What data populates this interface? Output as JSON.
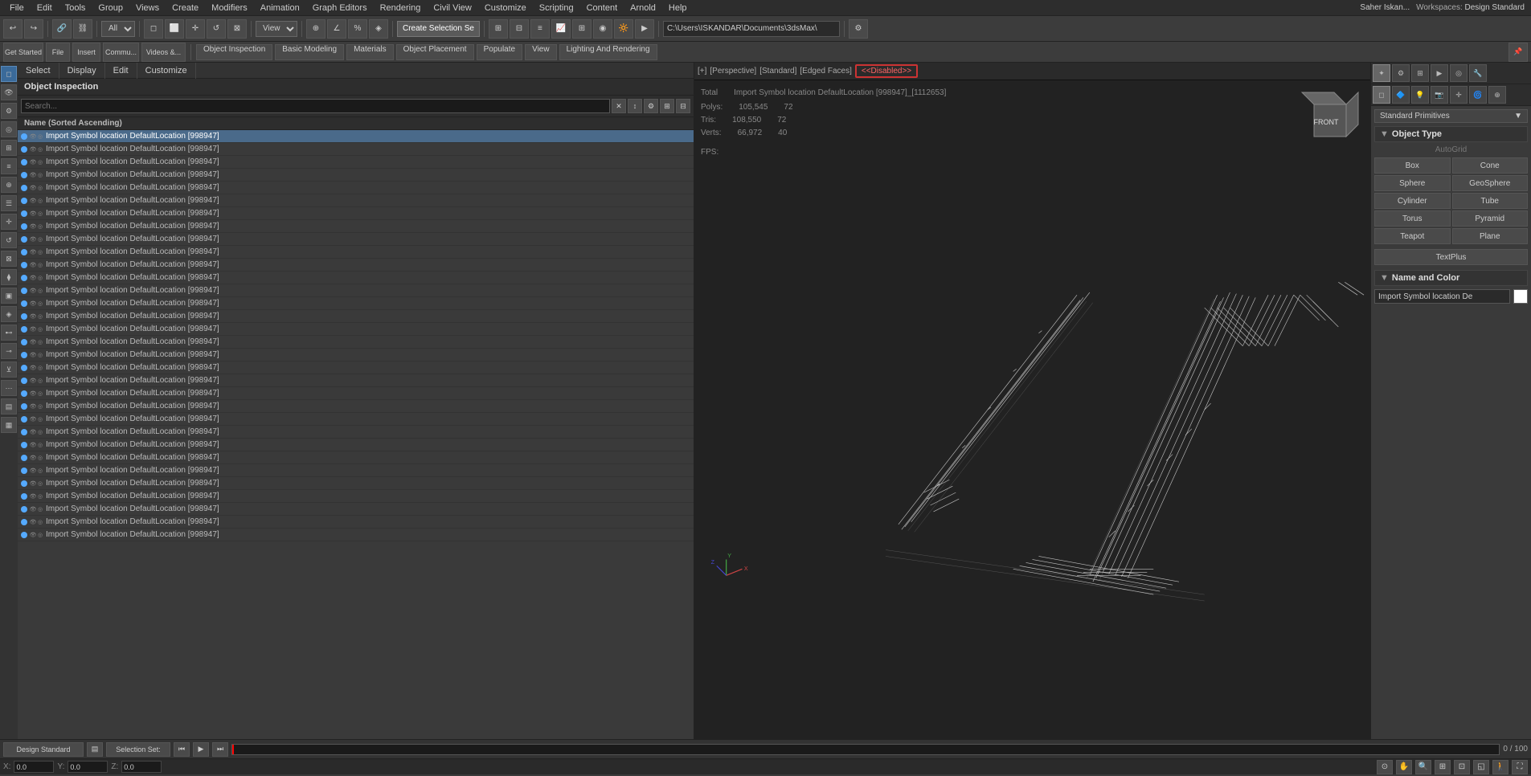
{
  "menu": {
    "items": [
      "File",
      "Edit",
      "Tools",
      "Group",
      "Views",
      "Create",
      "Modifiers",
      "Animation",
      "Graph Editors",
      "Rendering",
      "Civil View",
      "Customize",
      "Scripting",
      "Content",
      "Arnold",
      "Help"
    ]
  },
  "toolbar": {
    "create_selection_label": "Create Selection Se",
    "view_dropdown": "View",
    "all_dropdown": "All",
    "path": "C:\\Users\\ISKANDAR\\Documents\\3dsMax\\"
  },
  "toolbar2": {
    "get_started": "Get Started",
    "file": "File",
    "insert": "Insert",
    "community": "Commu...",
    "videos": "Videos &...",
    "object_inspection": "Object Inspection",
    "basic_modeling": "Basic Modeling",
    "materials": "Materials",
    "object_placement": "Object Placement",
    "populate": "Populate",
    "view": "View",
    "lighting_rendering": "Lighting And Rendering"
  },
  "scene_explorer": {
    "title": "Object Inspection",
    "column_header": "Name (Sorted Ascending)",
    "objects": [
      "Import Symbol location DefaultLocation [998947]",
      "Import Symbol location DefaultLocation [998947]",
      "Import Symbol location DefaultLocation [998947]",
      "Import Symbol location DefaultLocation [998947]",
      "Import Symbol location DefaultLocation [998947]",
      "Import Symbol location DefaultLocation [998947]",
      "Import Symbol location DefaultLocation [998947]",
      "Import Symbol location DefaultLocation [998947]",
      "Import Symbol location DefaultLocation [998947]",
      "Import Symbol location DefaultLocation [998947]",
      "Import Symbol location DefaultLocation [998947]",
      "Import Symbol location DefaultLocation [998947]",
      "Import Symbol location DefaultLocation [998947]",
      "Import Symbol location DefaultLocation [998947]",
      "Import Symbol location DefaultLocation [998947]",
      "Import Symbol location DefaultLocation [998947]",
      "Import Symbol location DefaultLocation [998947]",
      "Import Symbol location DefaultLocation [998947]",
      "Import Symbol location DefaultLocation [998947]",
      "Import Symbol location DefaultLocation [998947]",
      "Import Symbol location DefaultLocation [998947]",
      "Import Symbol location DefaultLocation [998947]",
      "Import Symbol location DefaultLocation [998947]",
      "Import Symbol location DefaultLocation [998947]",
      "Import Symbol location DefaultLocation [998947]",
      "Import Symbol location DefaultLocation [998947]",
      "Import Symbol location DefaultLocation [998947]",
      "Import Symbol location DefaultLocation [998947]",
      "Import Symbol location DefaultLocation [998947]",
      "Import Symbol location DefaultLocation [998947]",
      "Import Symbol location DefaultLocation [998947]",
      "Import Symbol location DefaultLocation [998947]"
    ]
  },
  "viewport": {
    "label_plus": "[+]",
    "label_perspective": "[Perspective]",
    "label_standard": "[Standard]",
    "label_edged": "[Edged Faces]",
    "label_disabled": "<<Disabled>>",
    "stats": {
      "total_label": "Total",
      "polys_label": "Polys:",
      "polys_total": "105,545",
      "polys_selected": "72",
      "tris_label": "Tris:",
      "tris_total": "108,550",
      "tris_selected": "72",
      "verts_label": "Verts:",
      "verts_total": "66,972",
      "verts_selected": "40"
    },
    "selected_object": "Import Symbol location DefaultLocation [998947]_[1112653]",
    "fps_label": "FPS:"
  },
  "right_panel": {
    "title": "Standard Primitives",
    "object_type_header": "Object Type",
    "autogrid": "AutoGrid",
    "buttons": [
      "Box",
      "Cone",
      "Sphere",
      "GeoSphere",
      "Cylinder",
      "Tube",
      "Torus",
      "Pyramid",
      "Teapot",
      "Plane",
      "TextPlus"
    ],
    "name_color_header": "Name and Color",
    "name_value": "Import Symbol location De",
    "color_swatch": "#ffffff"
  },
  "nav_tabs": [
    "Select",
    "Display",
    "Edit",
    "Customize"
  ],
  "status_bar": {
    "workspace": "Design Standard",
    "selection": "Selection Set:",
    "frame": "0 / 100"
  },
  "timeline": {
    "current_frame": "0",
    "total_frames": "100"
  }
}
